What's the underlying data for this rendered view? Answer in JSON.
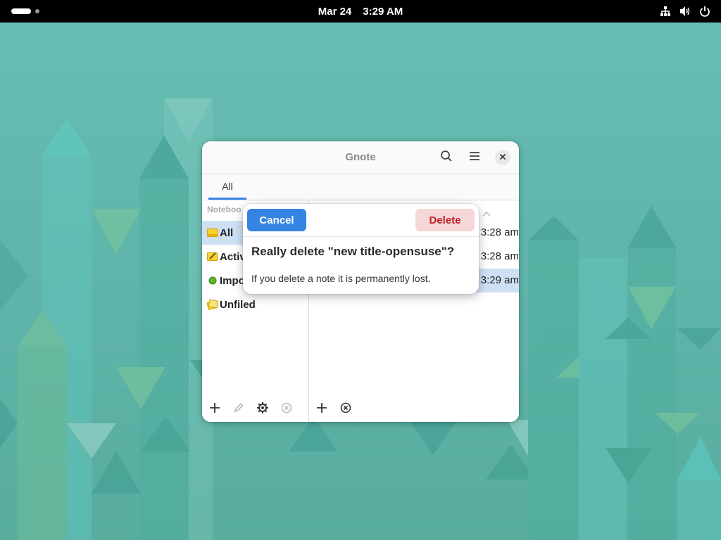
{
  "topbar": {
    "date": "Mar 24",
    "time": "3:29 AM",
    "icons": [
      "network-icon",
      "volume-icon",
      "power-icon"
    ]
  },
  "window": {
    "title": "Gnote",
    "tabs": [
      {
        "label": "All",
        "active": true
      }
    ],
    "sidebar": {
      "header": "Noteboo",
      "items": [
        {
          "label": "All",
          "icon": "all-notes-icon",
          "selected": true
        },
        {
          "label": "Activ",
          "icon": "active-notes-icon",
          "selected": false
        },
        {
          "label": "Impo",
          "icon": "important-icon",
          "selected": false
        },
        {
          "label": "Unfiled",
          "icon": "unfiled-icon",
          "selected": false
        }
      ]
    },
    "notes": [
      {
        "time": "3:28 am",
        "selected": false
      },
      {
        "time": "3:28 am",
        "selected": false
      },
      {
        "time": "3:29 am",
        "selected": true
      }
    ]
  },
  "dialog": {
    "cancel_label": "Cancel",
    "delete_label": "Delete",
    "title": "Really delete \"new title-opensuse\"?",
    "body": "If you delete a note it is permanently lost."
  },
  "colors": {
    "accent": "#3584e4",
    "destructive": "#c01c28",
    "destructive_bg": "#f5d7d7",
    "selection": "#cfe0f5",
    "wallpaper": "#5fb6ab"
  }
}
